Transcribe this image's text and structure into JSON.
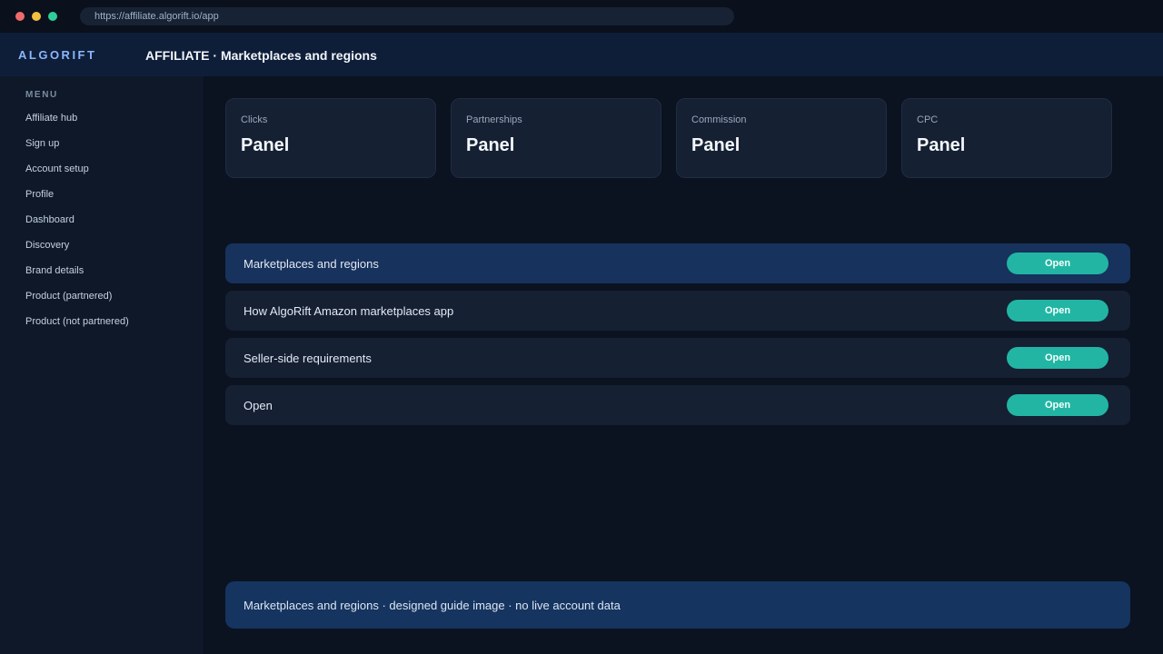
{
  "browser": {
    "url": "https://affiliate.algorift.io/app"
  },
  "header": {
    "brand": "ALGORIFT",
    "title": "AFFILIATE · Marketplaces and regions"
  },
  "sidebar": {
    "menu_label": "MENU",
    "items": [
      {
        "label": "Affiliate hub"
      },
      {
        "label": "Sign up"
      },
      {
        "label": "Account setup"
      },
      {
        "label": "Profile"
      },
      {
        "label": "Dashboard"
      },
      {
        "label": "Discovery"
      },
      {
        "label": "Brand details"
      },
      {
        "label": "Product (partnered)"
      },
      {
        "label": "Product (not partnered)"
      }
    ]
  },
  "stats": [
    {
      "label": "Clicks",
      "value": "Panel"
    },
    {
      "label": "Partnerships",
      "value": "Panel"
    },
    {
      "label": "Commission",
      "value": "Panel"
    },
    {
      "label": "CPC",
      "value": "Panel"
    }
  ],
  "rows": [
    {
      "label": "Marketplaces and regions",
      "button": "Open",
      "active": true
    },
    {
      "label": "How AlgoRift Amazon marketplaces app",
      "button": "Open",
      "active": false
    },
    {
      "label": "Seller-side requirements",
      "button": "Open",
      "active": false
    },
    {
      "label": "Open",
      "button": "Open",
      "active": false
    }
  ],
  "footer": {
    "note": "Marketplaces and regions · designed guide image · no live account data"
  },
  "colors": {
    "accent": "#22b5a4",
    "brand": "#8ab6ff",
    "active_row": "#17325c",
    "background": "#0b1220"
  }
}
